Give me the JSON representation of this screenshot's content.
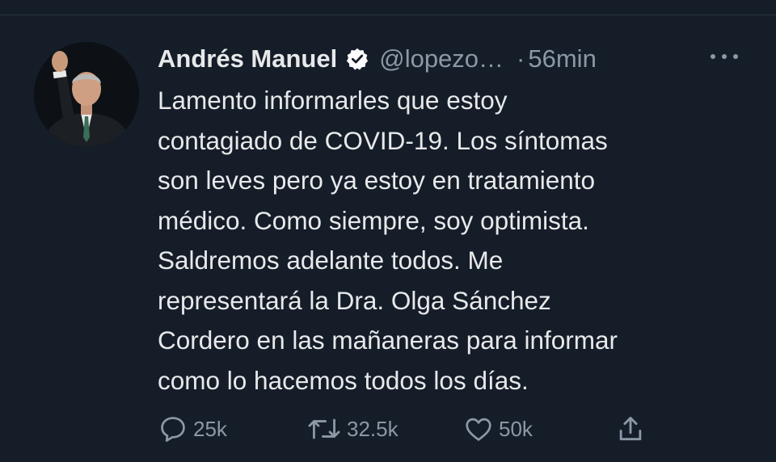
{
  "tweet": {
    "author_name": "Andrés Manuel",
    "handle": "@lopezo…",
    "separator": "·",
    "time": "56min",
    "text_lines": [
      "Lamento informarles que estoy",
      "contagiado de COVID-19. Los síntomas",
      "son leves pero ya estoy en tratamiento",
      "médico. Como siempre, soy optimista.",
      "Saldremos adelante todos. Me",
      "representará la Dra. Olga Sánchez",
      "Cordero en las mañaneras para informar",
      "como lo hacemos todos los días."
    ]
  },
  "actions": {
    "replies": "25k",
    "retweets": "32.5k",
    "likes": "50k"
  },
  "icons": {
    "verified": "verified-badge-icon",
    "more": "more-options-icon",
    "reply": "reply-icon",
    "retweet": "retweet-icon",
    "like": "heart-icon",
    "share": "share-icon"
  },
  "colors": {
    "background": "#151d29",
    "primary_text": "#e7e9ea",
    "secondary_text": "#8b98a5"
  }
}
